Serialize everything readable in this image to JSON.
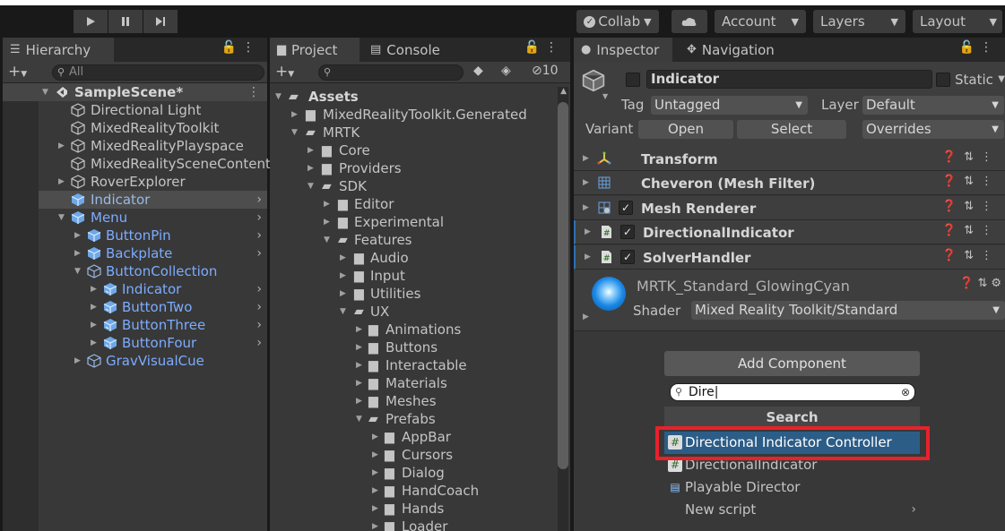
{
  "toolbar": {
    "collab_label": "Collab",
    "account_label": "Account",
    "layers_label": "Layers",
    "layout_label": "Layout"
  },
  "hierarchy": {
    "tab_label": "Hierarchy",
    "search_placeholder": "All",
    "scene": "SampleScene*",
    "items": [
      {
        "label": "Directional Light"
      },
      {
        "label": "MixedRealityToolkit"
      },
      {
        "label": "MixedRealityPlayspace"
      },
      {
        "label": "MixedRealitySceneContent"
      },
      {
        "label": "RoverExplorer"
      },
      {
        "label": "Indicator"
      },
      {
        "label": "Menu"
      },
      {
        "label": "ButtonPin"
      },
      {
        "label": "Backplate"
      },
      {
        "label": "ButtonCollection"
      },
      {
        "label": "Indicator"
      },
      {
        "label": "ButtonTwo"
      },
      {
        "label": "ButtonThree"
      },
      {
        "label": "ButtonFour"
      },
      {
        "label": "GravVisualCue"
      }
    ]
  },
  "project": {
    "tab_label": "Project",
    "console_label": "Console",
    "hidden_count": "10",
    "folders": [
      {
        "label": "Assets"
      },
      {
        "label": "MixedRealityToolkit.Generated"
      },
      {
        "label": "MRTK"
      },
      {
        "label": "Core"
      },
      {
        "label": "Providers"
      },
      {
        "label": "SDK"
      },
      {
        "label": "Editor"
      },
      {
        "label": "Experimental"
      },
      {
        "label": "Features"
      },
      {
        "label": "Audio"
      },
      {
        "label": "Input"
      },
      {
        "label": "Utilities"
      },
      {
        "label": "UX"
      },
      {
        "label": "Animations"
      },
      {
        "label": "Buttons"
      },
      {
        "label": "Interactable"
      },
      {
        "label": "Materials"
      },
      {
        "label": "Meshes"
      },
      {
        "label": "Prefabs"
      },
      {
        "label": "AppBar"
      },
      {
        "label": "Cursors"
      },
      {
        "label": "Dialog"
      },
      {
        "label": "HandCoach"
      },
      {
        "label": "Hands"
      },
      {
        "label": "Loader"
      }
    ]
  },
  "inspector": {
    "tab_label": "Inspector",
    "navigation_label": "Navigation",
    "object_name": "Indicator",
    "static_label": "Static",
    "tag_label": "Tag",
    "tag_value": "Untagged",
    "layer_label": "Layer",
    "layer_value": "Default",
    "variant_label": "Variant",
    "open_label": "Open",
    "select_label": "Select",
    "overrides_label": "Overrides",
    "components": [
      {
        "name": "Transform"
      },
      {
        "name": "Cheveron (Mesh Filter)"
      },
      {
        "name": "Mesh Renderer"
      },
      {
        "name": "DirectionalIndicator"
      },
      {
        "name": "SolverHandler"
      }
    ],
    "material_name": "MRTK_Standard_GlowingCyan",
    "shader_label": "Shader",
    "shader_value": "Mixed Reality Toolkit/Standard",
    "add_component_label": "Add Component"
  },
  "popup": {
    "search_value": "Dire",
    "header": "Search",
    "items": [
      {
        "label": "Directional Indicator Controller"
      },
      {
        "label": "DirectionalIndicator"
      },
      {
        "label": "Playable Director"
      },
      {
        "label": "New script"
      }
    ]
  },
  "colors": {
    "prefab_blue": "#7cacff",
    "highlight": "#2c5d87",
    "annotation_red": "#e8212b"
  }
}
